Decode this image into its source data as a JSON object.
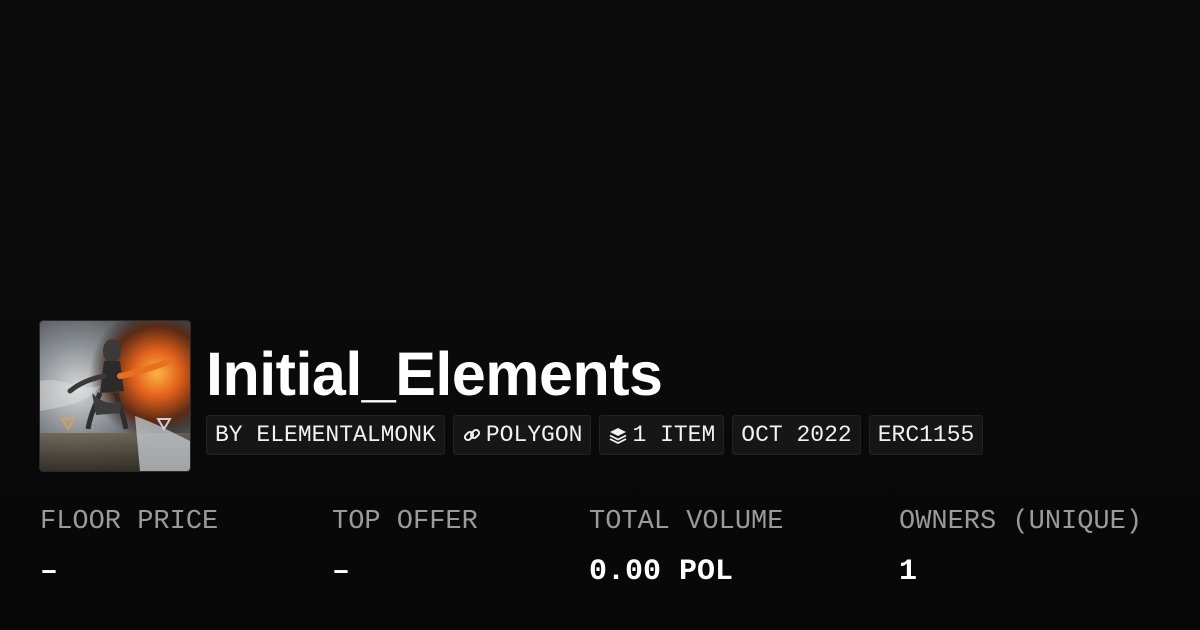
{
  "collection": {
    "title": "Initial_Elements",
    "thumbnail_icon": "collection-artwork-image"
  },
  "tags": [
    {
      "label": "BY ELEMENTALMONK",
      "icon": null
    },
    {
      "label": "POLYGON",
      "icon": "chain-link-icon"
    },
    {
      "label": "1 ITEM",
      "icon": "stack-layers-icon"
    },
    {
      "label": "OCT 2022",
      "icon": null
    },
    {
      "label": "ERC1155",
      "icon": null
    }
  ],
  "stats": {
    "floor_price": {
      "label": "FLOOR PRICE",
      "value": "–"
    },
    "top_offer": {
      "label": "TOP OFFER",
      "value": "–"
    },
    "total_volume": {
      "label": "TOTAL VOLUME",
      "value": "0.00 POL"
    },
    "owners": {
      "label": "OWNERS (UNIQUE)",
      "value": "1"
    }
  },
  "colors": {
    "background": "#0b0b0b",
    "text_primary": "#ffffff",
    "text_muted": "#9a9a9a",
    "tag_background": "#161616"
  }
}
